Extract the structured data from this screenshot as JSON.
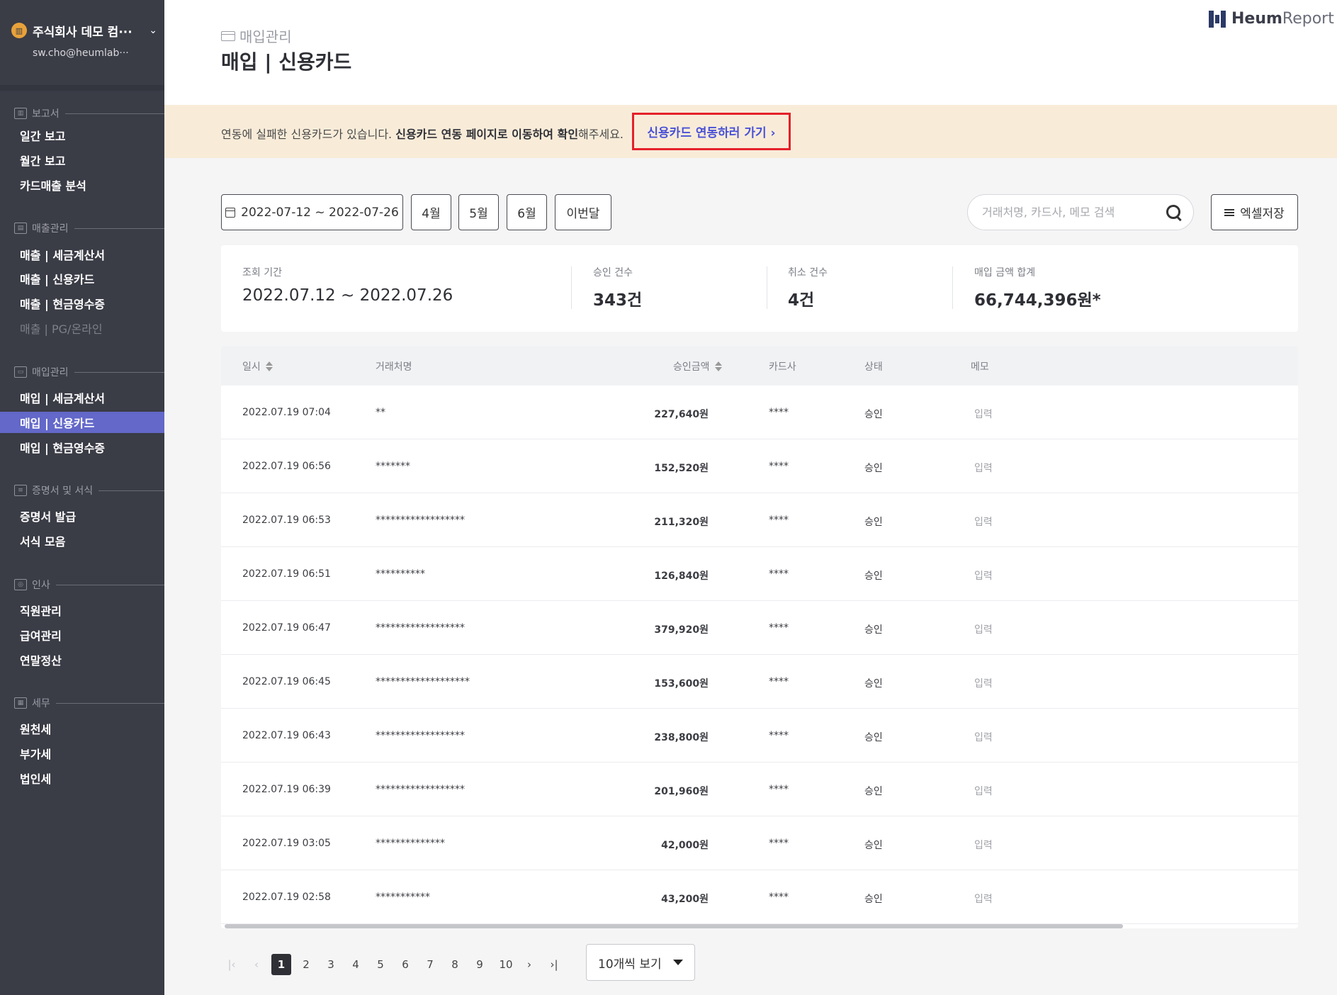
{
  "sidebar": {
    "company_logo": "▥",
    "company": "주식회사 데모 컴···",
    "chevron": "⌄",
    "email": "sw.cho@heumlab···",
    "sections": [
      {
        "label": "보고서",
        "icon": "report-icon"
      },
      {
        "label": "매출관리",
        "icon": "sales-chart-icon"
      },
      {
        "label": "매입관리",
        "icon": "purchase-card-icon"
      },
      {
        "label": "증명서 및 서식",
        "icon": "document-icon"
      },
      {
        "label": "인사",
        "icon": "people-icon"
      },
      {
        "label": "세무",
        "icon": "tax-calculator-icon"
      }
    ],
    "items": [
      {
        "label": "일간 보고"
      },
      {
        "label": "월간 보고"
      },
      {
        "label": "카드매출 분석"
      },
      {
        "label": "매출 | 세금계산서"
      },
      {
        "label": "매출 | 신용카드"
      },
      {
        "label": "매출 | 현금영수증"
      },
      {
        "label": "매출 | PG/온라인"
      },
      {
        "label": "매입 | 세금계산서"
      },
      {
        "label": "매입 | 신용카드"
      },
      {
        "label": "매입 | 현금영수증"
      },
      {
        "label": "증명서 발급"
      },
      {
        "label": "서식 모음"
      },
      {
        "label": "직원관리"
      },
      {
        "label": "급여관리"
      },
      {
        "label": "연말정산"
      },
      {
        "label": "원천세"
      },
      {
        "label": "부가세"
      },
      {
        "label": "법인세"
      }
    ],
    "active_index": 8,
    "disabled_index": 6,
    "active_color": "#6368c9"
  },
  "header": {
    "breadcrumb": "매입관리",
    "title": "매입 | 신용카드",
    "brand_bold": "Heum",
    "brand_light": "Report"
  },
  "alert": {
    "text_before": "연동에 실패한 신용카드가 있습니다. ",
    "text_bold": "신용카드 연동 페이지로 이동하여 확인",
    "text_after": "해주세요.",
    "link": "신용카드 연동하러 가기 ›"
  },
  "filters": {
    "date_range": "2022-07-12 ~ 2022-07-26",
    "months": [
      "4월",
      "5월",
      "6월",
      "이번달"
    ],
    "search_placeholder": "거래처명, 카드사, 메모 검색",
    "export": "엑셀저장"
  },
  "summary": {
    "period_label": "조회 기간",
    "period_value": "2022.07.12 ~ 2022.07.26",
    "approved_label": "승인 건수",
    "approved_value": "343건",
    "cancel_label": "취소 건수",
    "cancel_value": "4건",
    "total_label": "매입 금액 합계",
    "total_value": "66,744,396원*"
  },
  "table": {
    "columns": [
      "일시",
      "거래처명",
      "승인금액",
      "카드사",
      "상태",
      "메모"
    ],
    "rows": [
      {
        "datetime": "2022.07.19 07:04",
        "merchant": "**",
        "amount": "227,640원",
        "card": "****",
        "status": "승인",
        "memo": "입력"
      },
      {
        "datetime": "2022.07.19 06:56",
        "merchant": "*******",
        "amount": "152,520원",
        "card": "****",
        "status": "승인",
        "memo": "입력"
      },
      {
        "datetime": "2022.07.19 06:53",
        "merchant": "******************",
        "amount": "211,320원",
        "card": "****",
        "status": "승인",
        "memo": "입력"
      },
      {
        "datetime": "2022.07.19 06:51",
        "merchant": "**********",
        "amount": "126,840원",
        "card": "****",
        "status": "승인",
        "memo": "입력"
      },
      {
        "datetime": "2022.07.19 06:47",
        "merchant": "******************",
        "amount": "379,920원",
        "card": "****",
        "status": "승인",
        "memo": "입력"
      },
      {
        "datetime": "2022.07.19 06:45",
        "merchant": "*******************",
        "amount": "153,600원",
        "card": "****",
        "status": "승인",
        "memo": "입력"
      },
      {
        "datetime": "2022.07.19 06:43",
        "merchant": "******************",
        "amount": "238,800원",
        "card": "****",
        "status": "승인",
        "memo": "입력"
      },
      {
        "datetime": "2022.07.19 06:39",
        "merchant": "******************",
        "amount": "201,960원",
        "card": "****",
        "status": "승인",
        "memo": "입력"
      },
      {
        "datetime": "2022.07.19 03:05",
        "merchant": "**************",
        "amount": "42,000원",
        "card": "****",
        "status": "승인",
        "memo": "입력"
      },
      {
        "datetime": "2022.07.19 02:58",
        "merchant": "***********",
        "amount": "43,200원",
        "card": "****",
        "status": "승인",
        "memo": "입력"
      }
    ]
  },
  "pagination": {
    "first": "|‹",
    "prev": "‹",
    "pages": [
      "1",
      "2",
      "3",
      "4",
      "5",
      "6",
      "7",
      "8",
      "9",
      "10"
    ],
    "current": "1",
    "next": "›",
    "last": "›|",
    "page_size": "10개씩 보기"
  }
}
